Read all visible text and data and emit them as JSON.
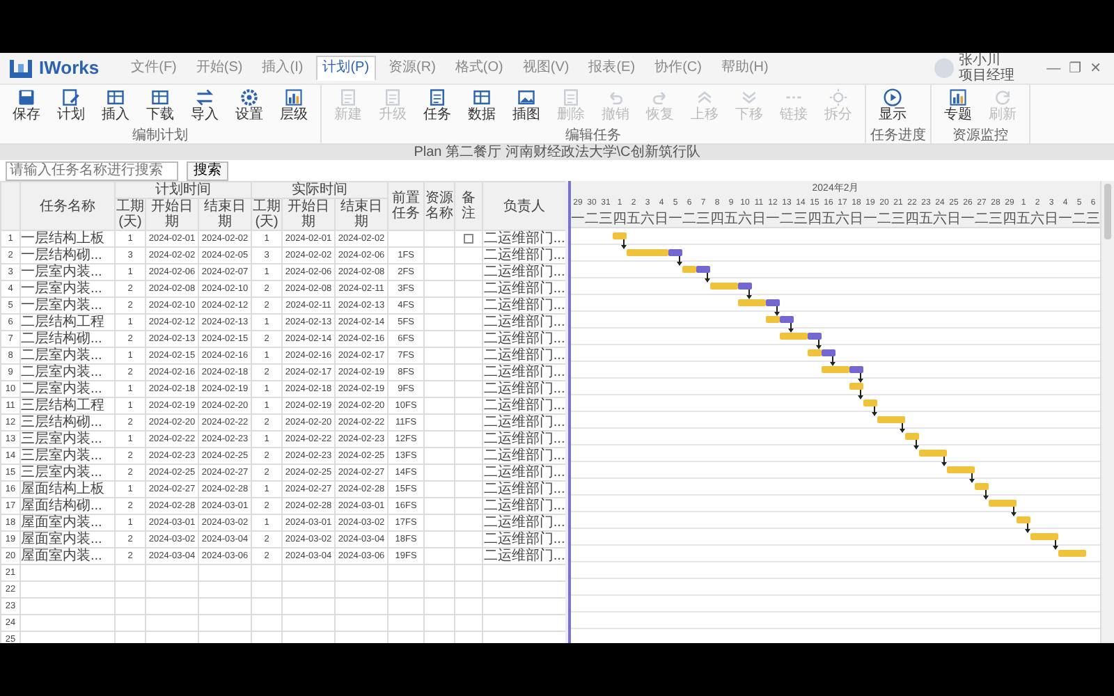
{
  "app": {
    "name": "IWorks"
  },
  "menu_tabs": [
    {
      "label": "文件(F)",
      "selected": false
    },
    {
      "label": "开始(S)",
      "selected": false
    },
    {
      "label": "插入(I)",
      "selected": false
    },
    {
      "label": "计划(P)",
      "selected": true
    },
    {
      "label": "资源(R)",
      "selected": false
    },
    {
      "label": "格式(O)",
      "selected": false
    },
    {
      "label": "视图(V)",
      "selected": false
    },
    {
      "label": "报表(E)",
      "selected": false
    },
    {
      "label": "协作(C)",
      "selected": false
    },
    {
      "label": "帮助(H)",
      "selected": false
    }
  ],
  "user": {
    "name": "张小川",
    "role": "项目经理"
  },
  "window_controls": [
    "—",
    "❐",
    "✕"
  ],
  "ribbon_groups": [
    {
      "label": "编制计划",
      "buttons": [
        {
          "label": "保存",
          "kind": "save",
          "disabled": false
        },
        {
          "label": "计划",
          "kind": "edit",
          "disabled": false
        },
        {
          "label": "插入",
          "kind": "grid",
          "disabled": false
        },
        {
          "label": "下载",
          "kind": "grid",
          "disabled": false
        },
        {
          "label": "导入",
          "kind": "swap",
          "disabled": false
        },
        {
          "label": "设置",
          "kind": "gear",
          "disabled": false
        },
        {
          "label": "层级",
          "kind": "chart",
          "disabled": false
        }
      ]
    },
    {
      "label": "编辑任务",
      "buttons": [
        {
          "label": "新建",
          "kind": "doc",
          "disabled": true
        },
        {
          "label": "升级",
          "kind": "doc",
          "disabled": true
        },
        {
          "label": "任务",
          "kind": "doc",
          "disabled": false
        },
        {
          "label": "数据",
          "kind": "grid",
          "disabled": false
        },
        {
          "label": "插图",
          "kind": "image",
          "disabled": false
        },
        {
          "label": "删除",
          "kind": "doc",
          "disabled": true
        },
        {
          "label": "撤销",
          "kind": "undo",
          "disabled": true
        },
        {
          "label": "恢复",
          "kind": "redo",
          "disabled": true
        },
        {
          "label": "上移",
          "kind": "up",
          "disabled": true
        },
        {
          "label": "下移",
          "kind": "down",
          "disabled": true
        },
        {
          "label": "链接",
          "kind": "link",
          "disabled": true
        },
        {
          "label": "拆分",
          "kind": "sun",
          "disabled": true
        }
      ]
    },
    {
      "label": "任务进度",
      "buttons": [
        {
          "label": "显示",
          "kind": "play",
          "disabled": false
        }
      ]
    },
    {
      "label": "资源监控",
      "buttons": [
        {
          "label": "专题",
          "kind": "chart",
          "disabled": false
        },
        {
          "label": "刷新",
          "kind": "refresh",
          "disabled": true
        }
      ]
    }
  ],
  "plan_title": "Plan 第二餐厅 河南财经政法大学\\C创新筑行队",
  "search": {
    "placeholder": "请输入任务名称进行搜索",
    "button": "搜索"
  },
  "table": {
    "name_header": "任务名称",
    "plan_header": "计划时间",
    "actual_header": "实际时间",
    "plan_sub_headers": [
      "工期(天)",
      "开始日期",
      "结束日期"
    ],
    "actual_sub_headers": [
      "工期(天)",
      "开始日期",
      "结束日期"
    ],
    "predecessor_header": "前置任务",
    "resource_header": "资源名称",
    "note_header": "备注",
    "owner_header": "负责人",
    "rows": [
      {
        "number": "1",
        "name": "一层结构上板",
        "plan": [
          "1",
          "2024-02-01",
          "2024-02-02"
        ],
        "actual": [
          "1",
          "2024-02-01",
          "2024-02-02"
        ],
        "has_note": true,
        "owner": "二运维部门..."
      },
      {
        "number": "2",
        "name": "一层结构砌...",
        "plan": [
          "3",
          "2024-02-02",
          "2024-02-05"
        ],
        "actual": [
          "3",
          "2024-02-02",
          "2024-02-06"
        ],
        "predecessor": "1FS",
        "has_note": false,
        "owner": "二运维部门..."
      },
      {
        "number": "3",
        "name": "一层室内装...",
        "plan": [
          "1",
          "2024-02-06",
          "2024-02-07"
        ],
        "actual": [
          "1",
          "2024-02-06",
          "2024-02-08"
        ],
        "predecessor": "2FS",
        "has_note": false,
        "owner": "二运维部门..."
      },
      {
        "number": "4",
        "name": "一层室内装...",
        "plan": [
          "2",
          "2024-02-08",
          "2024-02-10"
        ],
        "actual": [
          "2",
          "2024-02-08",
          "2024-02-11"
        ],
        "predecessor": "3FS",
        "has_note": false,
        "owner": "二运维部门..."
      },
      {
        "number": "5",
        "name": "一层室内装...",
        "plan": [
          "2",
          "2024-02-10",
          "2024-02-12"
        ],
        "actual": [
          "2",
          "2024-02-11",
          "2024-02-13"
        ],
        "predecessor": "4FS",
        "has_note": false,
        "owner": "二运维部门..."
      },
      {
        "number": "6",
        "name": "二层结构工程",
        "plan": [
          "1",
          "2024-02-12",
          "2024-02-13"
        ],
        "actual": [
          "1",
          "2024-02-13",
          "2024-02-14"
        ],
        "predecessor": "5FS",
        "has_note": false,
        "owner": "二运维部门..."
      },
      {
        "number": "7",
        "name": "二层结构砌...",
        "plan": [
          "2",
          "2024-02-13",
          "2024-02-15"
        ],
        "actual": [
          "2",
          "2024-02-14",
          "2024-02-16"
        ],
        "predecessor": "6FS",
        "has_note": false,
        "owner": "二运维部门..."
      },
      {
        "number": "8",
        "name": "二层室内装...",
        "plan": [
          "1",
          "2024-02-15",
          "2024-02-16"
        ],
        "actual": [
          "1",
          "2024-02-16",
          "2024-02-17"
        ],
        "predecessor": "7FS",
        "has_note": false,
        "owner": "二运维部门..."
      },
      {
        "number": "9",
        "name": "二层室内装...",
        "plan": [
          "2",
          "2024-02-16",
          "2024-02-18"
        ],
        "actual": [
          "2",
          "2024-02-17",
          "2024-02-19"
        ],
        "predecessor": "8FS",
        "has_note": false,
        "owner": "二运维部门..."
      },
      {
        "number": "10",
        "name": "二层室内装...",
        "plan": [
          "1",
          "2024-02-18",
          "2024-02-19"
        ],
        "actual": [
          "1",
          "2024-02-18",
          "2024-02-19"
        ],
        "predecessor": "9FS",
        "has_note": false,
        "owner": "二运维部门..."
      },
      {
        "number": "11",
        "name": "三层结构工程",
        "plan": [
          "1",
          "2024-02-19",
          "2024-02-20"
        ],
        "actual": [
          "1",
          "2024-02-19",
          "2024-02-20"
        ],
        "predecessor": "10FS",
        "has_note": false,
        "owner": "二运维部门..."
      },
      {
        "number": "12",
        "name": "三层结构砌...",
        "plan": [
          "2",
          "2024-02-20",
          "2024-02-22"
        ],
        "actual": [
          "2",
          "2024-02-20",
          "2024-02-22"
        ],
        "predecessor": "11FS",
        "has_note": false,
        "owner": "二运维部门..."
      },
      {
        "number": "13",
        "name": "三层室内装...",
        "plan": [
          "1",
          "2024-02-22",
          "2024-02-23"
        ],
        "actual": [
          "1",
          "2024-02-22",
          "2024-02-23"
        ],
        "predecessor": "12FS",
        "has_note": false,
        "owner": "二运维部门..."
      },
      {
        "number": "14",
        "name": "三层室内装...",
        "plan": [
          "2",
          "2024-02-23",
          "2024-02-25"
        ],
        "actual": [
          "2",
          "2024-02-23",
          "2024-02-25"
        ],
        "predecessor": "13FS",
        "has_note": false,
        "owner": "二运维部门..."
      },
      {
        "number": "15",
        "name": "三层室内装...",
        "plan": [
          "2",
          "2024-02-25",
          "2024-02-27"
        ],
        "actual": [
          "2",
          "2024-02-25",
          "2024-02-27"
        ],
        "predecessor": "14FS",
        "has_note": false,
        "owner": "二运维部门..."
      },
      {
        "number": "16",
        "name": "屋面结构上板",
        "plan": [
          "1",
          "2024-02-27",
          "2024-02-28"
        ],
        "actual": [
          "1",
          "2024-02-27",
          "2024-02-28"
        ],
        "predecessor": "15FS",
        "has_note": false,
        "owner": "二运维部门..."
      },
      {
        "number": "17",
        "name": "屋面结构砌...",
        "plan": [
          "2",
          "2024-02-28",
          "2024-03-01"
        ],
        "actual": [
          "2",
          "2024-02-28",
          "2024-03-01"
        ],
        "predecessor": "16FS",
        "has_note": false,
        "owner": "二运维部门..."
      },
      {
        "number": "18",
        "name": "屋面室内装...",
        "plan": [
          "1",
          "2024-03-01",
          "2024-03-02"
        ],
        "actual": [
          "1",
          "2024-03-01",
          "2024-03-02"
        ],
        "predecessor": "17FS",
        "has_note": false,
        "owner": "二运维部门..."
      },
      {
        "number": "19",
        "name": "屋面室内装...",
        "plan": [
          "2",
          "2024-03-02",
          "2024-03-04"
        ],
        "actual": [
          "2",
          "2024-03-02",
          "2024-03-04"
        ],
        "predecessor": "18FS",
        "has_note": false,
        "owner": "二运维部门..."
      },
      {
        "number": "20",
        "name": "屋面室内装...",
        "plan": [
          "2",
          "2024-03-04",
          "2024-03-06"
        ],
        "actual": [
          "2",
          "2024-03-04",
          "2024-03-06"
        ],
        "predecessor": "19FS",
        "has_note": false,
        "owner": "二运维部门..."
      }
    ],
    "empty_rows": [
      "21",
      "22",
      "23",
      "24",
      "25"
    ]
  },
  "gantt": {
    "month": "2024年2月",
    "days": [
      "29",
      "30",
      "31",
      "1",
      "2",
      "3",
      "4",
      "5",
      "6",
      "7",
      "8",
      "9",
      "10",
      "11",
      "12",
      "13",
      "14",
      "15",
      "16",
      "17",
      "18",
      "19",
      "20",
      "21",
      "22",
      "23",
      "24",
      "25",
      "26",
      "27",
      "28",
      "29",
      "1",
      "2",
      "3",
      "4",
      "5",
      "6"
    ],
    "weekdays": [
      "一",
      "二",
      "三",
      "四",
      "五",
      "六",
      "日",
      "一",
      "二",
      "三",
      "四",
      "五",
      "六",
      "日",
      "一",
      "二",
      "三",
      "四",
      "五",
      "六",
      "日",
      "一",
      "二",
      "三",
      "四",
      "五",
      "六",
      "日",
      "一",
      "二",
      "三",
      "四",
      "五",
      "六",
      "日",
      "一",
      "二",
      "三"
    ]
  }
}
